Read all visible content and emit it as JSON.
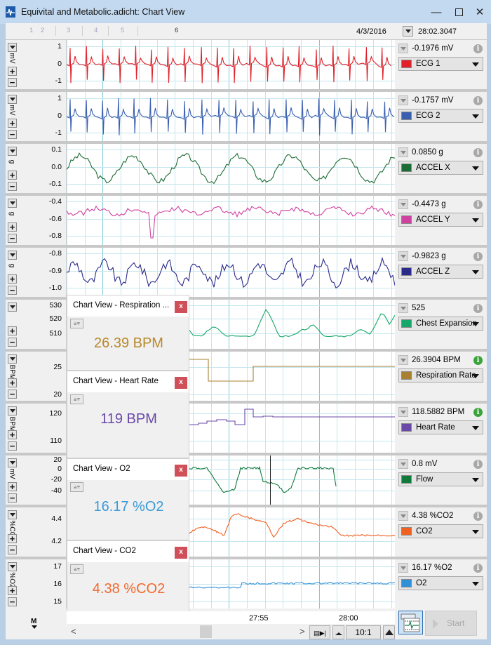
{
  "window": {
    "title": "Equivital and Metabolic.adicht: Chart View",
    "controls": [
      "minimize",
      "maximize",
      "close"
    ]
  },
  "topbar": {
    "page_tabs": [
      "1",
      "2",
      "3",
      "4",
      "5",
      "6"
    ],
    "current_page": "6",
    "date": "4/3/2016",
    "time": "28:02.3047"
  },
  "channels": [
    {
      "name": "ECG 1",
      "unit": "mV",
      "value": "-0.1976 mV",
      "color": "#e0202a",
      "yticks": [
        "1",
        "0",
        "-1"
      ],
      "info": "grey",
      "show_scale_down": true
    },
    {
      "name": "ECG 2",
      "unit": "mV",
      "value": "-0.1757 mV",
      "color": "#3a5fb0",
      "yticks": [
        "1",
        "0",
        "-1"
      ],
      "info": "grey",
      "show_scale_down": true
    },
    {
      "name": "ACCEL X",
      "unit": "g",
      "value": "0.0850 g",
      "color": "#1a6b34",
      "yticks": [
        "0.1",
        "0.0",
        "-0.1"
      ],
      "info": "grey",
      "show_scale_down": true
    },
    {
      "name": "ACCEL Y",
      "unit": "g",
      "value": "-0.4473 g",
      "color": "#d040a0",
      "yticks": [
        "-0.4",
        "-0.6",
        "-0.8"
      ],
      "info": "grey",
      "show_scale_down": true
    },
    {
      "name": "ACCEL Z",
      "unit": "g",
      "value": "-0.9823 g",
      "color": "#2a2a8a",
      "yticks": [
        "-0.8",
        "-0.9",
        "-1.0"
      ],
      "info": "grey",
      "show_scale_down": true
    },
    {
      "name": "Chest Expansion",
      "unit": "",
      "value": "525",
      "color": "#16a86a",
      "yticks": [
        "530",
        "520",
        "510"
      ],
      "info": "grey",
      "show_scale_down": true
    },
    {
      "name": "Respiration Rate",
      "unit": "BPM",
      "value": "26.3904 BPM",
      "color": "#a88030",
      "yticks": [
        "25",
        "20"
      ],
      "info": "green",
      "show_scale_down": true
    },
    {
      "name": "Heart Rate",
      "unit": "BPM",
      "value": "118.5882 BPM",
      "color": "#6a48a8",
      "yticks": [
        "120",
        "110"
      ],
      "info": "green",
      "show_scale_down": true
    },
    {
      "name": "Flow",
      "unit": "mV",
      "value": "0.8 mV",
      "color": "#0f7a3a",
      "yticks": [
        "20",
        "0",
        "-20",
        "-40"
      ],
      "info": "grey",
      "show_scale_down": true
    },
    {
      "name": "CO2",
      "unit": "%CO2",
      "value": "4.38 %CO2",
      "color": "#f06020",
      "yticks": [
        "4.4",
        "4.2"
      ],
      "info": "grey",
      "show_scale_down": true
    },
    {
      "name": "O2",
      "unit": "%O2",
      "value": "16.17 %O2",
      "color": "#3090d8",
      "yticks": [
        "17",
        "16",
        "15"
      ],
      "info": "grey",
      "show_scale_down": true
    }
  ],
  "popups": [
    {
      "title": "Chart View - Respiration ...",
      "value": "26.39 BPM",
      "color": "#b8882a",
      "close": "x"
    },
    {
      "title": "Chart View - Heart Rate",
      "value": "119 BPM",
      "color": "#6a48a8",
      "close": "x"
    },
    {
      "title": "Chart View - O2",
      "value": "16.17 %O2",
      "color": "#3a9ad8",
      "close": "x"
    },
    {
      "title": "Chart View - CO2",
      "value": "4.38 %CO2",
      "color": "#f06a30",
      "close": "x"
    }
  ],
  "xaxis": {
    "labels": [
      "27:55",
      "28:00"
    ]
  },
  "bottom": {
    "marker_label": "M",
    "scroll_left": "<",
    "scroll_right": ">",
    "zoom_ratio": "10:1",
    "start_label": "Start"
  }
}
